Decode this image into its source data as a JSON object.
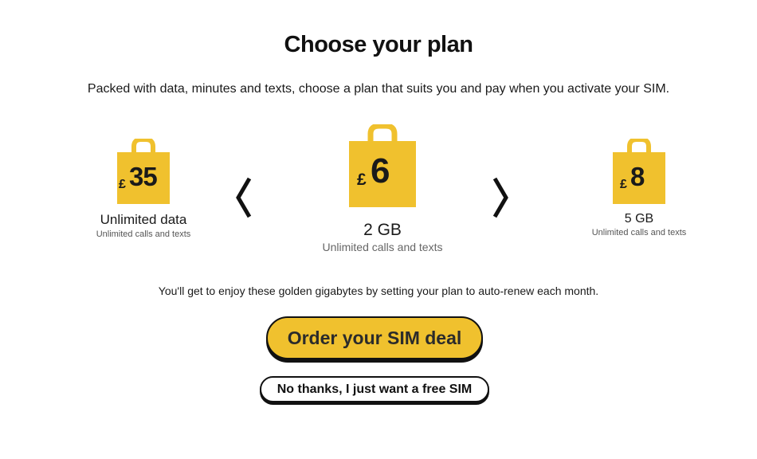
{
  "title": "Choose your plan",
  "subtitle": "Packed with data, minutes and texts, choose a plan that suits you and pay when you activate your SIM.",
  "plans": [
    {
      "currency": "£",
      "price": "35",
      "name": "Unlimited data",
      "description": "Unlimited calls and texts"
    },
    {
      "currency": "£",
      "price": "6",
      "name": "2 GB",
      "description": "Unlimited calls and texts"
    },
    {
      "currency": "£",
      "price": "8",
      "name": "5 GB",
      "description": "Unlimited calls and texts"
    }
  ],
  "navigation": {
    "prev_icon": "chevron-left-icon",
    "next_icon": "chevron-right-icon"
  },
  "note": "You'll get to enjoy these golden gigabytes by setting your plan to auto-renew each month.",
  "buttons": {
    "order_label": "Order your SIM deal",
    "free_sim_label": "No thanks, I just want a free SIM"
  },
  "colors": {
    "accent": "#f0c12e",
    "text": "#111111",
    "muted": "#555555"
  }
}
